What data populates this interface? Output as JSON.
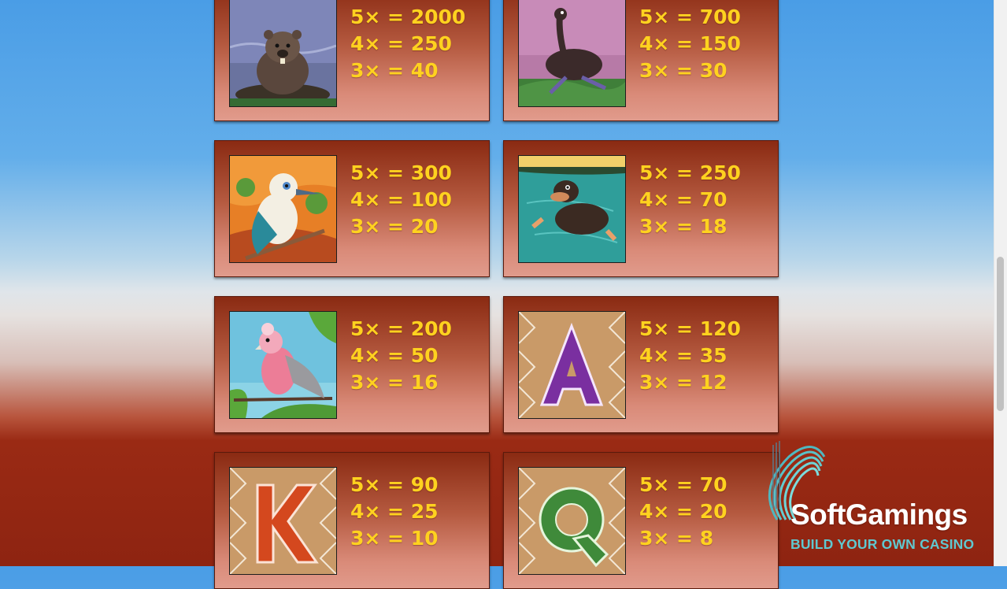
{
  "paytable": [
    {
      "symbol": "wombat-icon",
      "pays": [
        "5× = 2000",
        "4× = 250",
        "3× = 40"
      ]
    },
    {
      "symbol": "emu-icon",
      "pays": [
        "5× = 700",
        "4× = 150",
        "3× = 30"
      ]
    },
    {
      "symbol": "kookaburra-icon",
      "pays": [
        "5× = 300",
        "4× = 100",
        "3× = 20"
      ]
    },
    {
      "symbol": "platypus-icon",
      "pays": [
        "5× = 250",
        "4× = 70",
        "3× = 18"
      ]
    },
    {
      "symbol": "galah-icon",
      "pays": [
        "5× = 200",
        "4× = 50",
        "3× = 16"
      ]
    },
    {
      "symbol": "letter-a-icon",
      "pays": [
        "5× = 120",
        "4× = 35",
        "3× = 12"
      ]
    },
    {
      "symbol": "letter-k-icon",
      "pays": [
        "5× = 90",
        "4× = 25",
        "3× = 10"
      ]
    },
    {
      "symbol": "letter-q-icon",
      "pays": [
        "5× = 70",
        "4× = 20",
        "3× = 8"
      ]
    }
  ],
  "watermark": {
    "brand": "SoftGamings",
    "tagline": "BUILD YOUR OWN CASINO"
  },
  "colors": {
    "payout_text": "#ffd21f",
    "card_top": "#8a2a12",
    "card_bottom": "#e19b8c",
    "brand_teal": "#5fc8d0"
  }
}
